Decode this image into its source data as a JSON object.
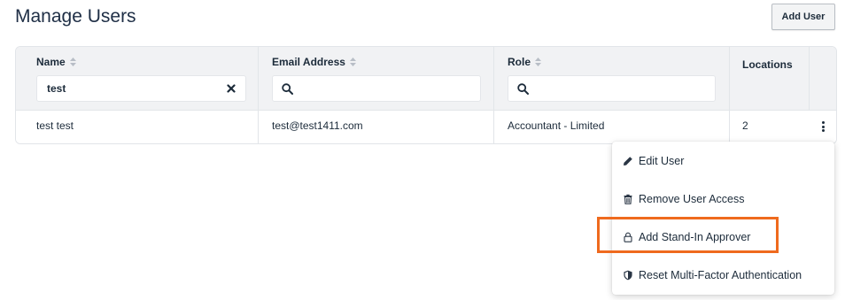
{
  "page": {
    "title": "Manage Users"
  },
  "toolbar": {
    "add_user_label": "Add User"
  },
  "table": {
    "columns": [
      {
        "label": "Name",
        "sortable": true,
        "filter_value": "test",
        "filter_type": "text-with-clear"
      },
      {
        "label": "Email Address",
        "sortable": true,
        "filter_value": "",
        "filter_type": "search"
      },
      {
        "label": "Role",
        "sortable": true,
        "filter_value": "",
        "filter_type": "search"
      },
      {
        "label": "Locations",
        "sortable": false
      }
    ],
    "rows": [
      {
        "name": "test test",
        "email": "test@test1411.com",
        "role": "Accountant - Limited",
        "locations": "2"
      }
    ]
  },
  "row_menu": {
    "items": [
      {
        "label": "Edit User",
        "icon": "pencil-icon"
      },
      {
        "label": "Remove User Access",
        "icon": "trash-icon"
      },
      {
        "label": "Add Stand-In Approver",
        "icon": "lock-icon",
        "highlighted": true
      },
      {
        "label": "Reset Multi-Factor Authentication",
        "icon": "shield-icon"
      }
    ]
  },
  "colors": {
    "highlight": "#ef6a1e",
    "header_bg": "#f1f2f4",
    "text": "#1c2b3a"
  }
}
